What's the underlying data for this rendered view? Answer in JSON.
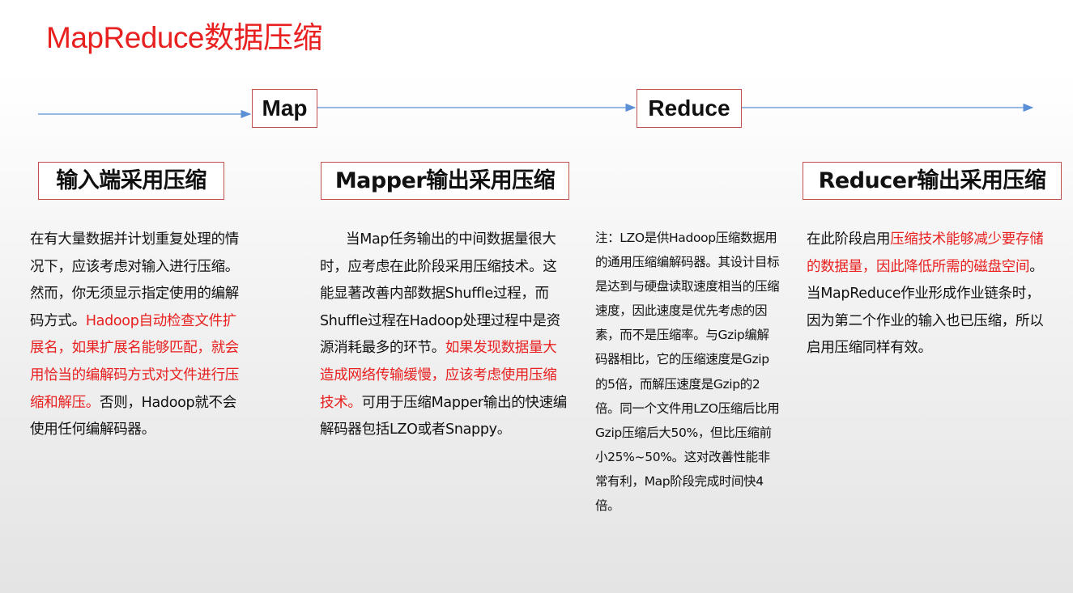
{
  "title": "MapReduce数据压缩",
  "stages": {
    "map": "Map",
    "reduce": "Reduce"
  },
  "sections": [
    {
      "heading": "输入端采用压缩",
      "text_a": "在有大量数据并计划重复处理的情况下，应该考虑对输入进行压缩。然而，你无须显示指定使用的编解码方式。",
      "text_red": "Hadoop自动检查文件扩展名，如果扩展名能够匹配，就会用恰当的编解码方式对文件进行压缩和解压。",
      "text_b": "否则，Hadoop就不会使用任何编解码器。"
    },
    {
      "heading": "Mapper输出采用压缩",
      "text_a": "当Map任务输出的中间数据量很大时，应考虑在此阶段采用压缩技术。这能显著改善内部数据Shuffle过程，而Shuffle过程在Hadoop处理过程中是资源消耗最多的环节。",
      "text_red": "如果发现数据量大造成网络传输缓慢，应该考虑使用压缩技术。",
      "text_b": "可用于压缩Mapper输出的快速编解码器包括LZO或者Snappy。"
    },
    {
      "note": "注：LZO是供Hadoop压缩数据用的通用压缩编解码器。其设计目标是达到与硬盘读取速度相当的压缩速度，因此速度是优先考虑的因素，而不是压缩率。与Gzip编解码器相比，它的压缩速度是Gzip的5倍，而解压速度是Gzip的2倍。同一个文件用LZO压缩后比用Gzip压缩后大50%，但比压缩前小25%~50%。这对改善性能非常有利，Map阶段完成时间快4倍。"
    },
    {
      "heading": "Reducer输出采用压缩",
      "text_a": "在此阶段启用",
      "text_red": "压缩技术能够减少要存储的数据量，因此降低所需的磁盘空间",
      "text_b": "。当MapReduce作业形成作业链条时，因为第二个作业的输入也已压缩，所以启用压缩同样有效。"
    }
  ],
  "colors": {
    "title": "#e8201f",
    "highlight": "#e8201f",
    "box_border": "#c0504d",
    "arrow": "#5b8fd6"
  }
}
